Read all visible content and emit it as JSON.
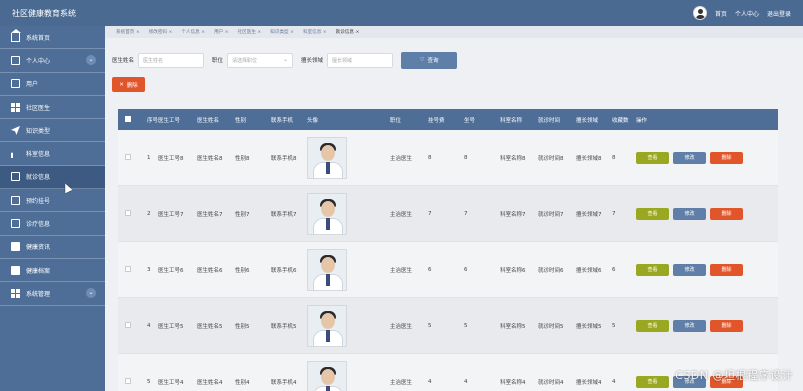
{
  "app": {
    "title": "社区健康教育系统"
  },
  "header": {
    "links": [
      "首页",
      "个人中心",
      "退出登录"
    ]
  },
  "sidebar": {
    "items": [
      {
        "label": "系统首页",
        "icon": "home-icon",
        "expandable": false
      },
      {
        "label": "个人中心",
        "icon": "card-icon",
        "expandable": true
      },
      {
        "label": "用户",
        "icon": "chart-icon",
        "expandable": false
      },
      {
        "label": "社区医生",
        "icon": "grid-icon",
        "expandable": false
      },
      {
        "label": "知识类型",
        "icon": "send-icon",
        "expandable": false
      },
      {
        "label": "科室信息",
        "icon": "bar-chart-icon",
        "expandable": false
      },
      {
        "label": "就诊信息",
        "icon": "monitor-icon",
        "expandable": false,
        "active": true
      },
      {
        "label": "预约挂号",
        "icon": "document-icon",
        "expandable": false
      },
      {
        "label": "诊疗信息",
        "icon": "list-icon",
        "expandable": false
      },
      {
        "label": "健康资讯",
        "icon": "book-icon",
        "expandable": false
      },
      {
        "label": "健康档案",
        "icon": "chat-icon",
        "expandable": false
      },
      {
        "label": "系统管理",
        "icon": "apps-icon",
        "expandable": true
      }
    ]
  },
  "tabs": [
    "系统首页 ×",
    "修改密码 ×",
    "个人信息 ×",
    "用户 ×",
    "社区医生 ×",
    "知识类型 ×",
    "科室信息 ×",
    "就诊信息 ×"
  ],
  "search": {
    "name_label": "医生姓名",
    "name_placeholder": "医生姓名",
    "position_label": "职位",
    "position_placeholder": "请选择职位",
    "field_label": "擅长领域",
    "field_placeholder": "擅长领域",
    "search_button": "查询"
  },
  "actions": {
    "delete_button": "删除"
  },
  "table": {
    "headers": [
      "序号",
      "医生工号",
      "医生姓名",
      "性别",
      "联系手机",
      "头像",
      "职位",
      "挂号费",
      "坐号",
      "科室名称",
      "就诊时间",
      "擅长领域",
      "收藏数",
      "操作"
    ],
    "rows": [
      {
        "no": "1",
        "gh": "医生工号8",
        "xm": "医生姓名8",
        "xb": "性别8",
        "lx": "联系手机8",
        "zw": "主治医生",
        "ghf": "8",
        "zh": "8",
        "ks": "科室名称8",
        "jz": "就诊时间8",
        "sc": "擅长领域8",
        "sl": "8"
      },
      {
        "no": "2",
        "gh": "医生工号7",
        "xm": "医生姓名7",
        "xb": "性别7",
        "lx": "联系手机7",
        "zw": "主治医生",
        "ghf": "7",
        "zh": "7",
        "ks": "科室名称7",
        "jz": "就诊时间7",
        "sc": "擅长领域7",
        "sl": "7"
      },
      {
        "no": "3",
        "gh": "医生工号6",
        "xm": "医生姓名6",
        "xb": "性别6",
        "lx": "联系手机6",
        "zw": "主治医生",
        "ghf": "6",
        "zh": "6",
        "ks": "科室名称6",
        "jz": "就诊时间6",
        "sc": "擅长领域6",
        "sl": "6"
      },
      {
        "no": "4",
        "gh": "医生工号5",
        "xm": "医生姓名5",
        "xb": "性别5",
        "lx": "联系手机5",
        "zw": "主治医生",
        "ghf": "5",
        "zh": "5",
        "ks": "科室名称5",
        "jz": "就诊时间5",
        "sc": "擅长领域5",
        "sl": "5"
      },
      {
        "no": "5",
        "gh": "医生工号4",
        "xm": "医生姓名4",
        "xb": "性别4",
        "lx": "联系手机4",
        "zw": "主治医生",
        "ghf": "4",
        "zh": "4",
        "ks": "科室名称4",
        "jz": "就诊时间4",
        "sc": "擅长领域4",
        "sl": "4"
      }
    ],
    "op_labels": {
      "view": "查看",
      "edit": "修改",
      "delete": "删除"
    }
  },
  "watermark": "CSDN @坦根程序设计",
  "colors": {
    "primary": "#4e6e98",
    "danger": "#e0562a",
    "view": "#9aa720"
  }
}
